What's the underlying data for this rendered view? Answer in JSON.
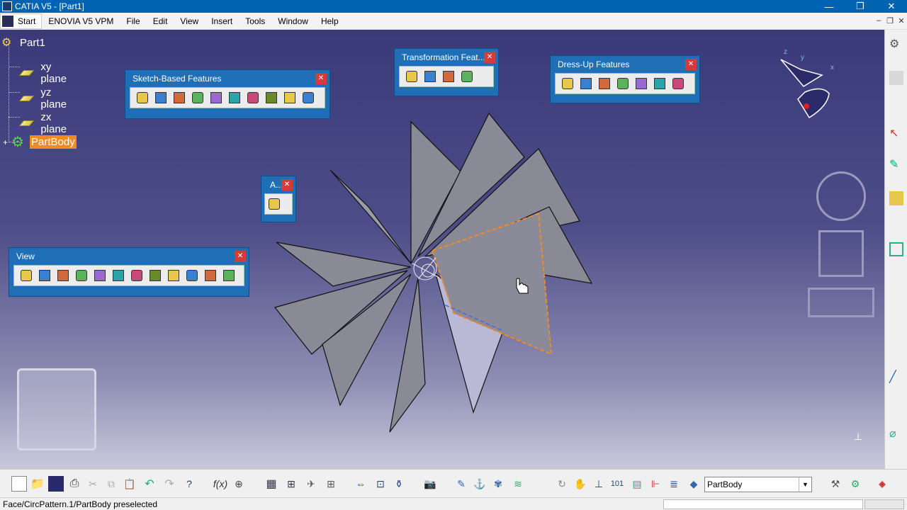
{
  "window": {
    "title": "CATIA V5 - [Part1]",
    "minimize": "—",
    "restore": "❐",
    "close": "✕"
  },
  "menu": {
    "start": "Start",
    "items": [
      "ENOVIA V5 VPM",
      "File",
      "Edit",
      "View",
      "Insert",
      "Tools",
      "Window",
      "Help"
    ],
    "mdi": [
      "–",
      "❐",
      "✕"
    ]
  },
  "tree": {
    "root": "Part1",
    "nodes": [
      "xy plane",
      "yz plane",
      "zx plane"
    ],
    "body": "PartBody"
  },
  "toolbars": {
    "sketch": {
      "title": "Sketch-Based Features",
      "icons": [
        "pad-icon",
        "pocket-icon",
        "shaft-icon",
        "groove-icon",
        "hole-icon",
        "rib-icon",
        "slot-icon",
        "stiffener-icon",
        "multi-section-solid-icon",
        "removed-multi-section-icon"
      ]
    },
    "transform": {
      "title": "Transformation Feat...",
      "icons": [
        "translation-icon",
        "mirror-icon",
        "circular-pattern-icon",
        "scaling-icon"
      ]
    },
    "dressup": {
      "title": "Dress-Up Features",
      "icons": [
        "edge-fillet-icon",
        "chamfer-icon",
        "draft-icon",
        "shell-icon",
        "thickness-icon",
        "thread-icon",
        "remove-face-icon"
      ]
    },
    "small": {
      "title": "A...",
      "icons": [
        "apply-material-icon"
      ]
    },
    "view": {
      "title": "View",
      "icons": [
        "fly-mode-icon",
        "fit-all-icon",
        "pan-icon",
        "rotate-icon",
        "zoom-in-icon",
        "zoom-out-icon",
        "normal-view-icon",
        "multi-view-icon",
        "iso-view-icon",
        "shading-icon",
        "hide-show-icon",
        "swap-visible-icon"
      ]
    }
  },
  "bottom": {
    "combo_value": "PartBody",
    "combo_arrow": "▼"
  },
  "status": {
    "text": "Face/CircPattern.1/PartBody preselected"
  },
  "compass": {
    "x": "x",
    "y": "y",
    "z": "z"
  },
  "colors": {
    "title_blue": "#0063b1",
    "toolbar_blue": "#1e6fb5",
    "highlight": "#f08a24",
    "viewport_top": "#3a3a7a",
    "viewport_bottom": "#c9c9dc"
  }
}
